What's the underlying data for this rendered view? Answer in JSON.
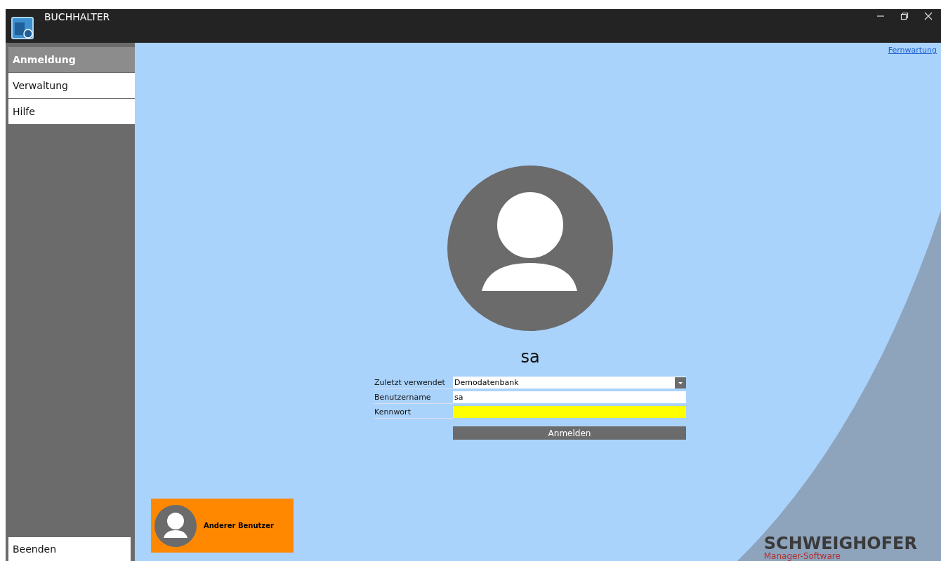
{
  "window": {
    "title": "BUCHHALTER"
  },
  "sidebar": {
    "items": [
      {
        "label": "Anmeldung",
        "selected": true
      },
      {
        "label": "Verwaltung",
        "selected": false
      },
      {
        "label": "Hilfe",
        "selected": false
      }
    ],
    "exit": "Beenden"
  },
  "remote_link": "Fernwartung",
  "user": {
    "name": "sa"
  },
  "form": {
    "fields": [
      {
        "kind": "dropdown",
        "label": "Zuletzt verwendet",
        "value": "Demodatenbank",
        "highlighted": false
      },
      {
        "kind": "text",
        "label": "Benutzername",
        "value": "sa",
        "highlighted": false
      },
      {
        "kind": "password",
        "label": "Kennwort",
        "highlighted": true
      }
    ],
    "submit": "Anmelden"
  },
  "other_user": "Anderer Benutzer",
  "brand": {
    "name": "SCHWEIGHOFER",
    "tagline": "Manager-Software"
  }
}
